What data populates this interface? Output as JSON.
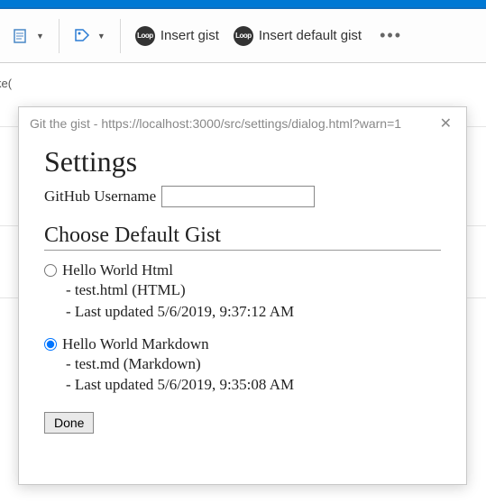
{
  "ribbon": {
    "insert_gist_label": "Insert gist",
    "insert_default_gist_label": "Insert default gist"
  },
  "background": {
    "fragment": "ke("
  },
  "dialog": {
    "title": "Git the gist - https://localhost:3000/src/settings/dialog.html?warn=1",
    "heading": "Settings",
    "username_label": "GitHub Username",
    "username_value": "",
    "choose_heading": "Choose Default Gist",
    "gists": [
      {
        "name": "Hello World Html",
        "file_line": "- test.html (HTML)",
        "updated_line": "- Last updated 5/6/2019, 9:37:12 AM",
        "selected": false
      },
      {
        "name": "Hello World Markdown",
        "file_line": "- test.md (Markdown)",
        "updated_line": "- Last updated 5/6/2019, 9:35:08 AM",
        "selected": true
      }
    ],
    "done_label": "Done"
  }
}
